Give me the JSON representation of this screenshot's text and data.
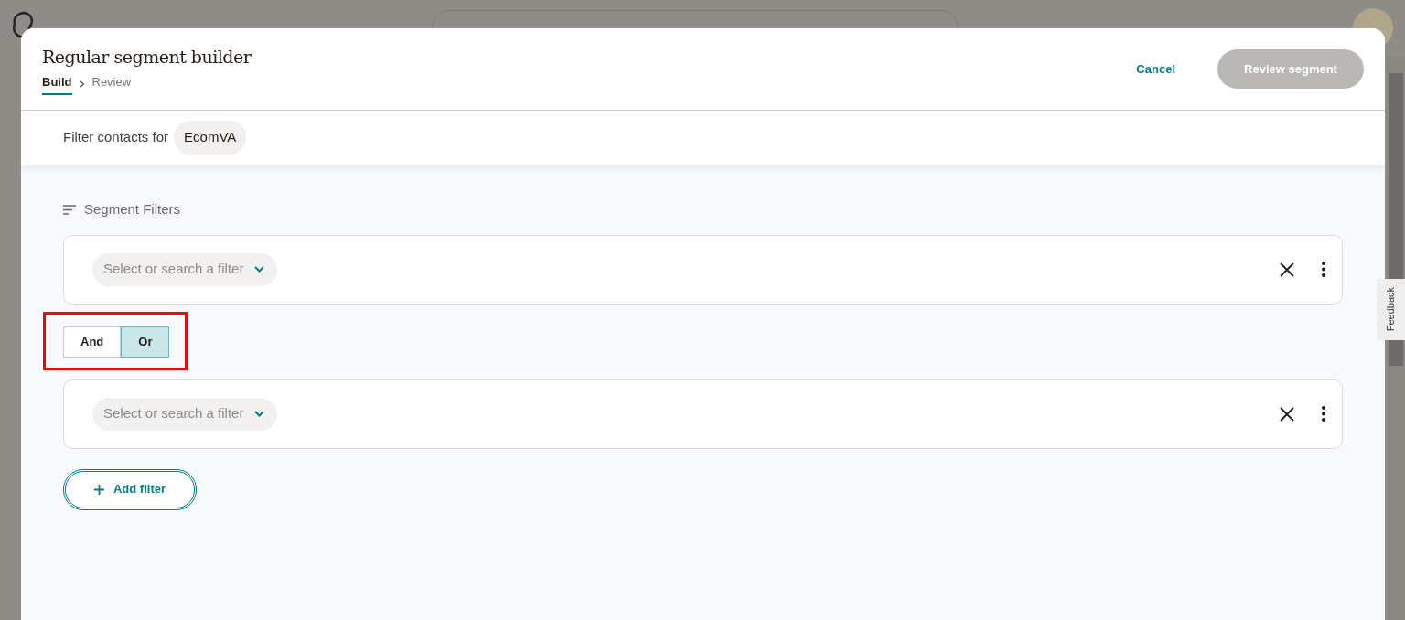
{
  "modal": {
    "title": "Regular segment builder",
    "steps": [
      {
        "label": "Build",
        "selected": true
      },
      {
        "label": "Review",
        "selected": false
      }
    ],
    "cancel": "Cancel",
    "review_button": {
      "label": "Review segment",
      "disabled": true
    }
  },
  "audience": {
    "label": "Filter contacts for",
    "name": "EcomVA"
  },
  "section_title": "Segment Filters",
  "filters": [
    {
      "placeholder": "Select or search a filter"
    },
    {
      "placeholder": "Select or search a filter"
    }
  ],
  "logic": {
    "highlighted": true,
    "options": [
      {
        "label": "And",
        "selected": false
      },
      {
        "label": "Or",
        "selected": true
      }
    ]
  },
  "add_filter": "Add filter",
  "feedback": "Feedback"
}
